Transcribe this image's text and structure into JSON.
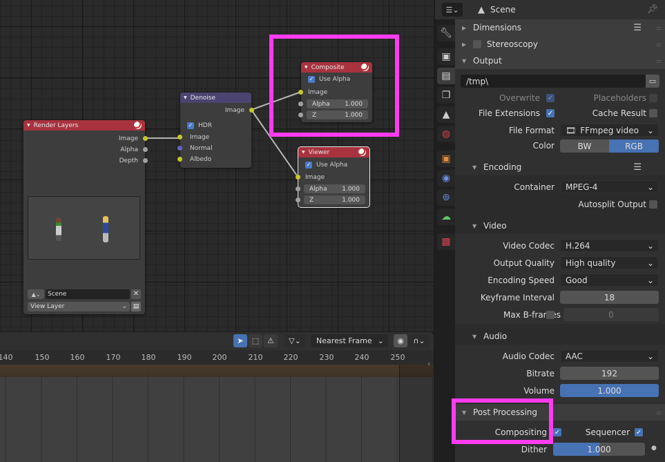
{
  "node_editor": {
    "nodes": {
      "render_layers": {
        "title": "Render Layers",
        "outputs": [
          "Image",
          "Alpha",
          "Depth"
        ],
        "scene_field": "Scene",
        "view_layer": "View Layer"
      },
      "denoise": {
        "title": "Denoise",
        "output": "Image",
        "hdr_label": "HDR",
        "hdr_checked": true,
        "inputs": [
          "Image",
          "Normal",
          "Albedo"
        ]
      },
      "composite": {
        "title": "Composite",
        "use_alpha_label": "Use Alpha",
        "use_alpha_checked": true,
        "image_label": "Image",
        "alpha_label": "Alpha",
        "alpha_value": "1.000",
        "z_label": "Z",
        "z_value": "1.000"
      },
      "viewer": {
        "title": "Viewer",
        "use_alpha_label": "Use Alpha",
        "use_alpha_checked": true,
        "image_label": "Image",
        "alpha_label": "Alpha",
        "alpha_value": "1.000",
        "z_label": "Z",
        "z_value": "1.000"
      }
    }
  },
  "timeline": {
    "snap_mode": "Nearest Frame",
    "ticks": [
      "140",
      "150",
      "160",
      "170",
      "180",
      "190",
      "200",
      "210",
      "220",
      "230",
      "240",
      "250"
    ]
  },
  "properties": {
    "header_title": "Scene",
    "panels": {
      "dimensions": "Dimensions",
      "stereoscopy": "Stereoscopy",
      "output": "Output",
      "encoding": "Encoding",
      "video": "Video",
      "audio": "Audio",
      "post_processing": "Post Processing"
    },
    "output": {
      "path": "/tmp\\",
      "overwrite_label": "Overwrite",
      "overwrite": true,
      "placeholders_label": "Placeholders",
      "placeholders": false,
      "file_extensions_label": "File Extensions",
      "file_extensions": true,
      "cache_result_label": "Cache Result",
      "cache_result": false,
      "file_format_label": "File Format",
      "file_format": "FFmpeg video",
      "color_label": "Color",
      "color_options": [
        "BW",
        "RGB"
      ],
      "color_selected": "RGB"
    },
    "encoding": {
      "container_label": "Container",
      "container": "MPEG-4",
      "autosplit_label": "Autosplit Output",
      "autosplit": false
    },
    "video": {
      "codec_label": "Video Codec",
      "codec": "H.264",
      "quality_label": "Output Quality",
      "quality": "High quality",
      "speed_label": "Encoding Speed",
      "speed": "Good",
      "keyframe_label": "Keyframe Interval",
      "keyframe": "18",
      "bframes_label": "Max B-frames",
      "bframes_enabled": false,
      "bframes": "0"
    },
    "audio": {
      "codec_label": "Audio Codec",
      "codec": "AAC",
      "bitrate_label": "Bitrate",
      "bitrate": "192",
      "volume_label": "Volume",
      "volume": "1.000"
    },
    "post_processing": {
      "compositing_label": "Compositing",
      "compositing": true,
      "sequencer_label": "Sequencer",
      "sequencer": true,
      "dither_label": "Dither",
      "dither": "1.000",
      "dither_fraction": 0.5
    }
  },
  "colors": {
    "accent": "#4772b3",
    "highlight": "#ff3cf0",
    "node_header_output": "#a8333f",
    "node_header_filter": "#4b4470"
  }
}
